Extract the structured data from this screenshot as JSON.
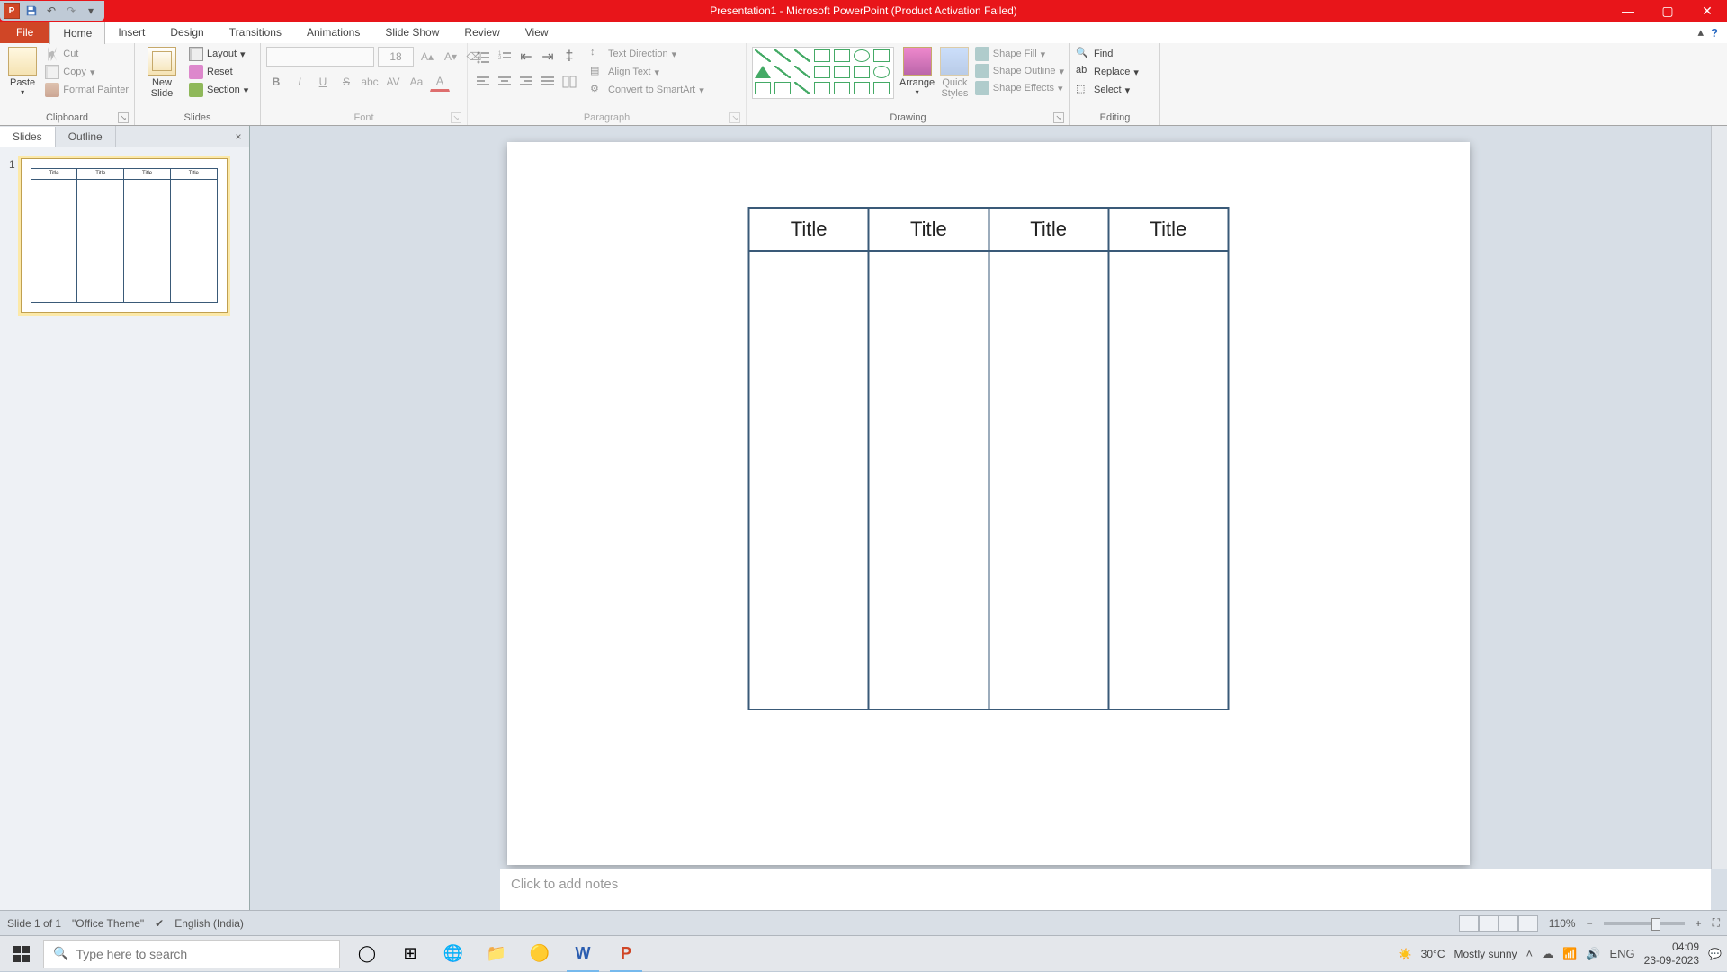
{
  "titlebar": {
    "title": "Presentation1 - Microsoft PowerPoint (Product Activation Failed)"
  },
  "tabs": {
    "file": "File",
    "home": "Home",
    "insert": "Insert",
    "design": "Design",
    "transitions": "Transitions",
    "animations": "Animations",
    "slideshow": "Slide Show",
    "review": "Review",
    "view": "View"
  },
  "ribbon": {
    "clipboard": {
      "label": "Clipboard",
      "paste": "Paste",
      "cut": "Cut",
      "copy": "Copy",
      "format_painter": "Format Painter"
    },
    "slides": {
      "label": "Slides",
      "new_slide": "New\nSlide",
      "layout": "Layout",
      "reset": "Reset",
      "section": "Section"
    },
    "font": {
      "label": "Font",
      "size": "18"
    },
    "paragraph": {
      "label": "Paragraph",
      "text_direction": "Text Direction",
      "align_text": "Align Text",
      "smartart": "Convert to SmartArt"
    },
    "drawing": {
      "label": "Drawing",
      "arrange": "Arrange",
      "quick_styles": "Quick\nStyles",
      "shape_fill": "Shape Fill",
      "shape_outline": "Shape Outline",
      "shape_effects": "Shape Effects"
    },
    "editing": {
      "label": "Editing",
      "find": "Find",
      "replace": "Replace",
      "select": "Select"
    }
  },
  "sidepane": {
    "slides_tab": "Slides",
    "outline_tab": "Outline",
    "thumb_number": "1",
    "thumb_titles": [
      "Title",
      "Title",
      "Title",
      "Title"
    ]
  },
  "slide": {
    "columns": [
      "Title",
      "Title",
      "Title",
      "Title"
    ]
  },
  "notes": {
    "placeholder": "Click to add notes"
  },
  "statusbar": {
    "slide": "Slide 1 of 1",
    "theme": "\"Office Theme\"",
    "language": "English (India)",
    "zoom": "110%"
  },
  "taskbar": {
    "search_placeholder": "Type here to search",
    "weather_temp": "30°C",
    "weather_desc": "Mostly sunny",
    "time": "04:09",
    "date": "23-09-2023"
  }
}
